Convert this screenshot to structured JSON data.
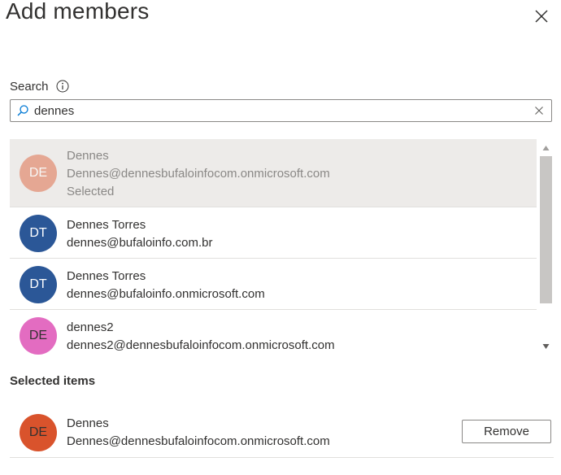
{
  "header": {
    "title": "Add members",
    "close_icon": "close-icon"
  },
  "search": {
    "label": "Search",
    "info_icon": "info-icon",
    "value": "dennes",
    "search_icon": "search-icon",
    "clear_icon": "clear-icon"
  },
  "results": {
    "items": [
      {
        "initials": "DE",
        "name": "Dennes",
        "email": "Dennes@dennesbufaloinfocom.onmicrosoft.com",
        "status": "Selected",
        "avatar_color": "#e07b5b"
      },
      {
        "initials": "DT",
        "name": "Dennes Torres",
        "email": "dennes@bufaloinfo.com.br",
        "avatar_color": "#2b5797"
      },
      {
        "initials": "DT",
        "name": "Dennes Torres",
        "email": "dennes@bufaloinfo.onmicrosoft.com",
        "avatar_color": "#2b5797"
      },
      {
        "initials": "DE",
        "name": "dennes2",
        "email": "dennes2@dennesbufaloinfocom.onmicrosoft.com",
        "avatar_color": "#e36cc1"
      }
    ]
  },
  "selected_items": {
    "title": "Selected items",
    "items": [
      {
        "initials": "DE",
        "name": "Dennes",
        "email": "Dennes@dennesbufaloinfocom.onmicrosoft.com",
        "avatar_color": "#d9532c",
        "remove_label": "Remove"
      }
    ]
  }
}
